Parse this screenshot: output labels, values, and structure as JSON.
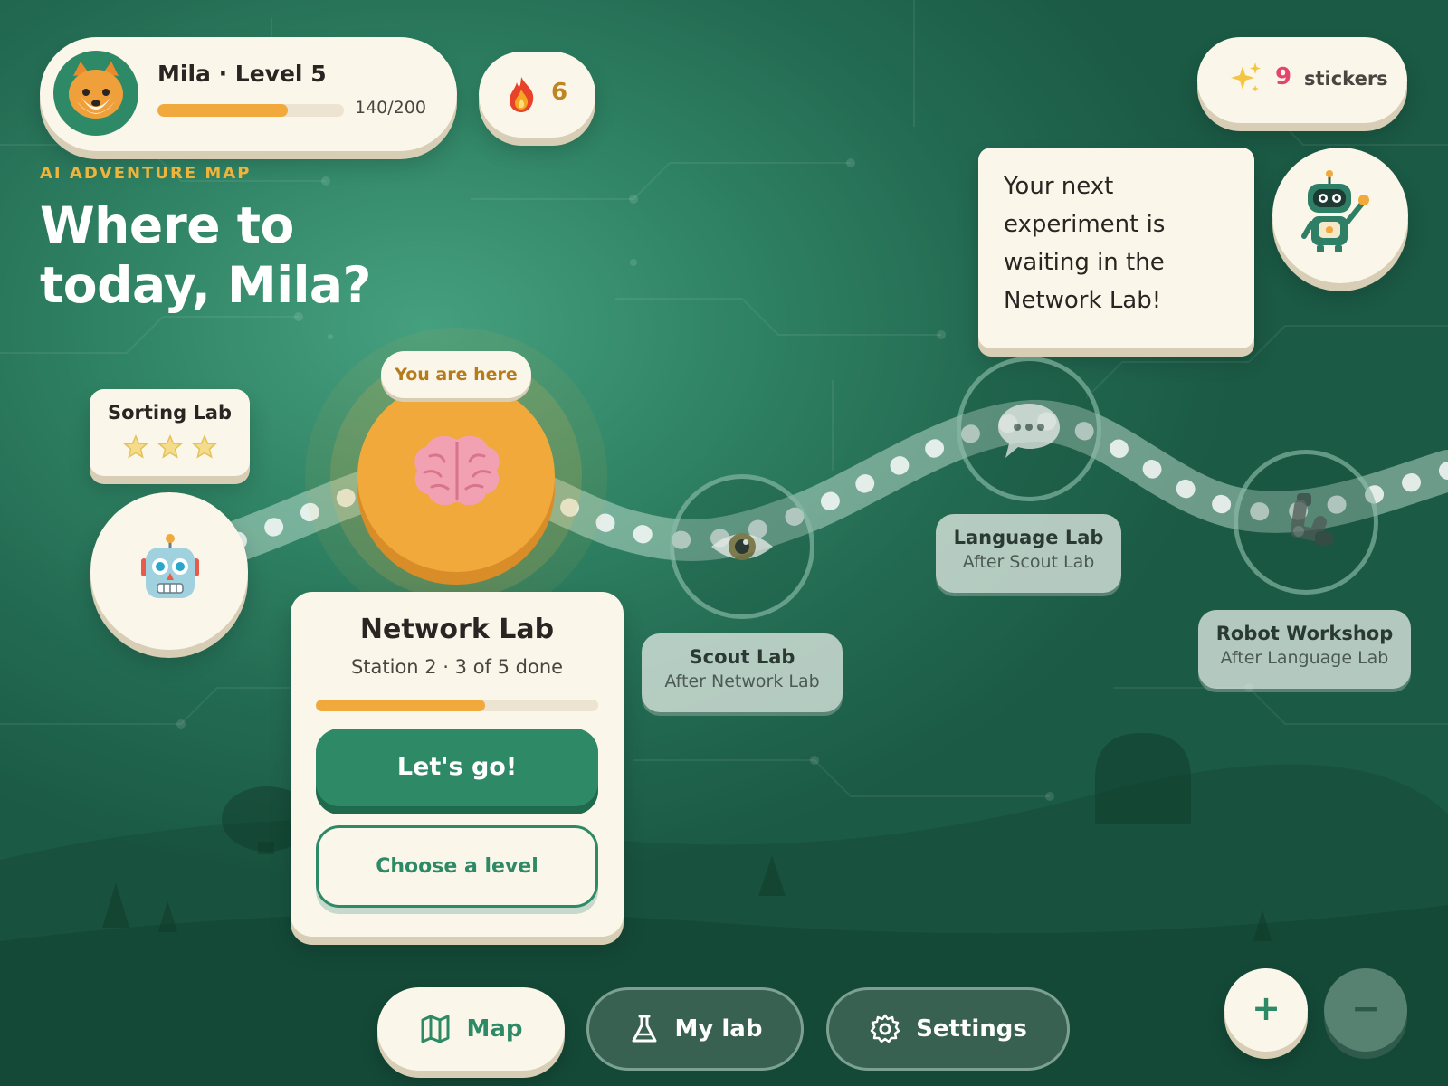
{
  "profile": {
    "name_level": "Mila · Level 5",
    "xp_text": "140/200",
    "xp_progress": 0.7,
    "avatar_icon": "fox-icon"
  },
  "streak": {
    "icon": "flame-icon",
    "count": "6"
  },
  "stickers": {
    "icon": "sparkles-icon",
    "count": "9",
    "label": "stickers"
  },
  "header": {
    "eyebrow": "AI ADVENTURE MAP",
    "title": "Where to today, Mila?"
  },
  "guide": {
    "message": "Your next experiment is waiting in the Network Lab!",
    "icon": "robot-waving-icon"
  },
  "map": {
    "completed": {
      "name": "Sorting Lab",
      "stars": 3,
      "icon": "robot-face-icon"
    },
    "current": {
      "tag": "You are here",
      "icon": "brain-icon"
    },
    "locked": [
      {
        "name": "Scout Lab",
        "unlock": "After Network Lab",
        "icon": "eye-icon"
      },
      {
        "name": "Language Lab",
        "unlock": "After Scout Lab",
        "icon": "speech-bubble-icon"
      },
      {
        "name": "Robot Workshop",
        "unlock": "After Language Lab",
        "icon": "mechanical-arm-icon"
      }
    ]
  },
  "current_lab": {
    "title": "Network Lab",
    "subtitle": "Station 2 · 3 of 5 done",
    "progress": 0.6,
    "primary_label": "Let's go!",
    "secondary_label": "Choose a level"
  },
  "nav": {
    "items": [
      {
        "label": "Map",
        "icon": "map-icon",
        "active": true
      },
      {
        "label": "My lab",
        "icon": "flask-icon",
        "active": false
      },
      {
        "label": "Settings",
        "icon": "gear-icon",
        "active": false
      }
    ]
  },
  "zoom": {
    "in_label": "+",
    "out_label": "−"
  },
  "colors": {
    "primary": "#2e8a66",
    "accent": "#f0a93a",
    "card": "#fbf6ea",
    "sticker": "#e2456d"
  }
}
